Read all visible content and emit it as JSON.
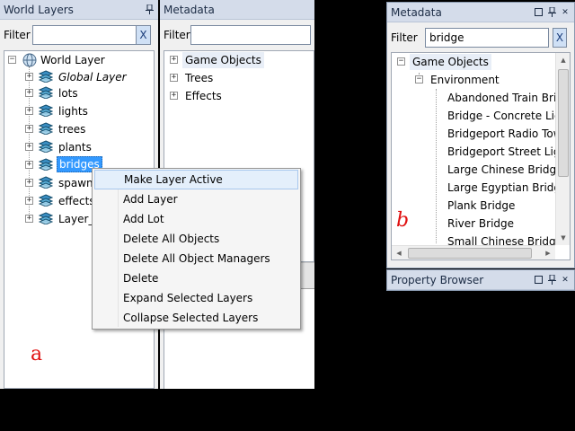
{
  "world_layers": {
    "title": "World Layers",
    "filter_label": "Filter",
    "filter_value": "",
    "clear_label": "X",
    "tree": [
      {
        "label": "World Layer"
      },
      {
        "label": "Global Layer"
      },
      {
        "label": "lots"
      },
      {
        "label": "lights"
      },
      {
        "label": "trees"
      },
      {
        "label": "plants"
      },
      {
        "label": "bridges"
      },
      {
        "label": "spawne"
      },
      {
        "label": "effects"
      },
      {
        "label": "Layer_8"
      }
    ]
  },
  "metadata_left": {
    "title": "Metadata",
    "filter_label": "Filter",
    "filter_value": "",
    "tree": [
      {
        "label": "Game Objects"
      },
      {
        "label": "Trees"
      },
      {
        "label": "Effects"
      }
    ]
  },
  "context_menu": {
    "items": [
      {
        "label": "Make Layer Active"
      },
      {
        "label": "Add Layer"
      },
      {
        "label": "Add Lot"
      },
      {
        "label": "Delete All Objects"
      },
      {
        "label": "Delete All Object Managers"
      },
      {
        "label": "Delete"
      },
      {
        "label": "Expand Selected Layers"
      },
      {
        "label": "Collapse Selected Layers"
      }
    ]
  },
  "metadata_right": {
    "title": "Metadata",
    "filter_label": "Filter",
    "filter_value": "bridge",
    "clear_label": "X",
    "tree": [
      {
        "label": "Game Objects"
      },
      {
        "label": "Environment"
      },
      {
        "label": "Abandoned Train Bridg"
      },
      {
        "label": "Bridge - Concrete Ligh"
      },
      {
        "label": "Bridgeport Radio Towe"
      },
      {
        "label": "Bridgeport Street Light"
      },
      {
        "label": "Large Chinese Bridge"
      },
      {
        "label": "Large Egyptian Bridge"
      },
      {
        "label": "Plank Bridge"
      },
      {
        "label": "River Bridge"
      },
      {
        "label": "Small Chinese Bridge"
      }
    ]
  },
  "property_browser": {
    "title": "Property Browser"
  },
  "annotations": {
    "a": "a",
    "b": "b"
  },
  "colors": {
    "annotation": "#e01010",
    "titlebar": "#d4dcea",
    "selection": "#3399ff"
  }
}
